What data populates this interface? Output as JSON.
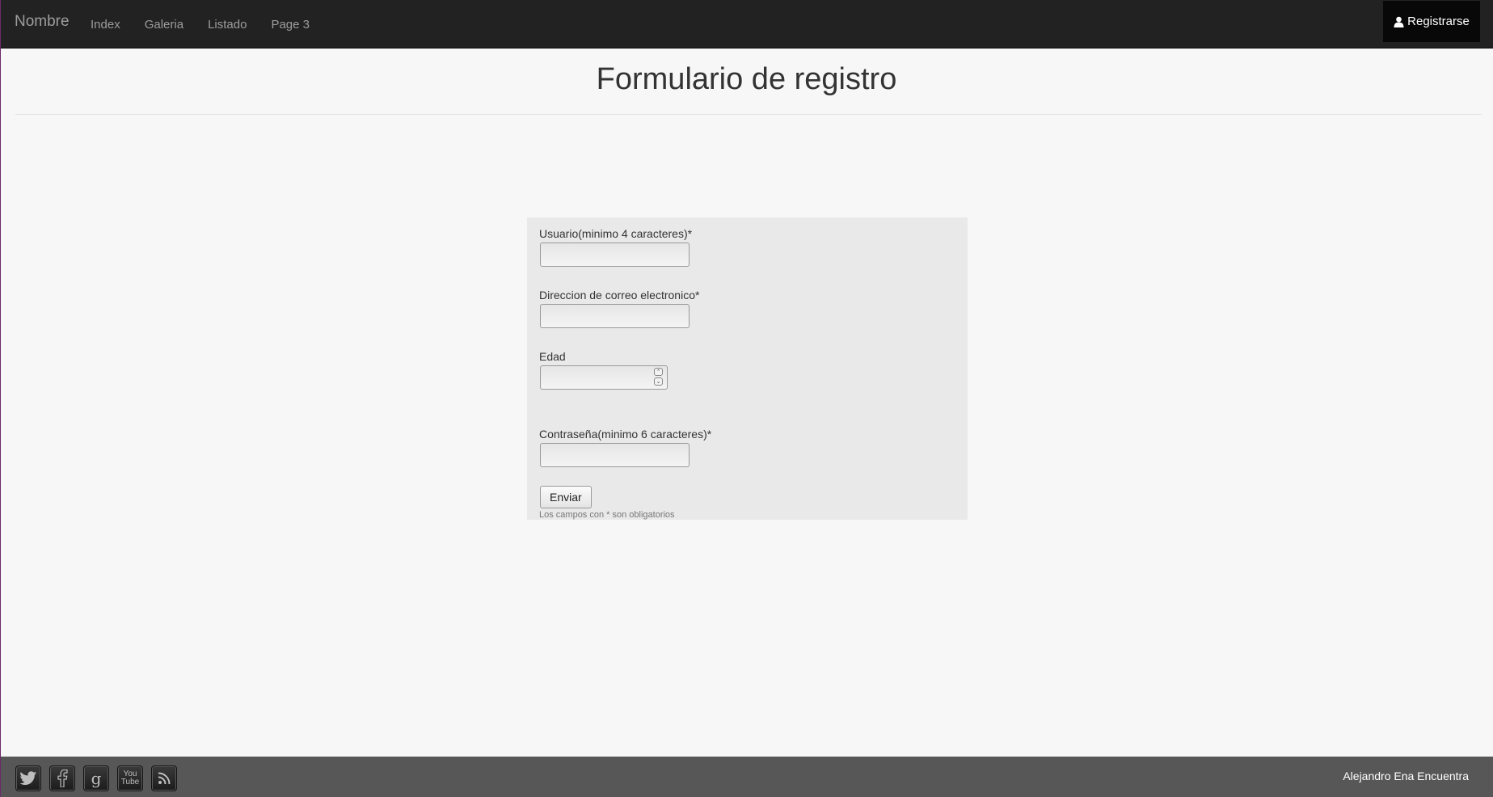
{
  "navbar": {
    "brand": "Nombre",
    "links": [
      "Index",
      "Galeria",
      "Listado",
      "Page 3"
    ],
    "register_label": "Registrarse",
    "register_icon": "user-icon"
  },
  "header": {
    "title": "Formulario de registro"
  },
  "form": {
    "username_label": "Usuario(minimo 4 caracteres)*",
    "username_value": "",
    "email_label": "Direccion de correo electronico*",
    "email_value": "",
    "age_label": "Edad",
    "age_value": "",
    "password_label": "Contraseña(minimo 6 caracteres)*",
    "password_value": "",
    "submit_label": "Enviar",
    "required_note": "Los campos con * son obligatorios"
  },
  "footer": {
    "social_icons": [
      "twitter-icon",
      "facebook-icon",
      "google-icon",
      "youtube-icon",
      "rss-icon"
    ],
    "youtube_text_top": "You",
    "youtube_text_bottom": "Tube",
    "credit": "Alejandro Ena Encuentra"
  },
  "colors": {
    "navbar_bg": "#222222",
    "register_bg": "#080808",
    "page_bg": "#f7f7f7",
    "form_bg": "#e9e9e9",
    "footer_bg": "#575757"
  }
}
